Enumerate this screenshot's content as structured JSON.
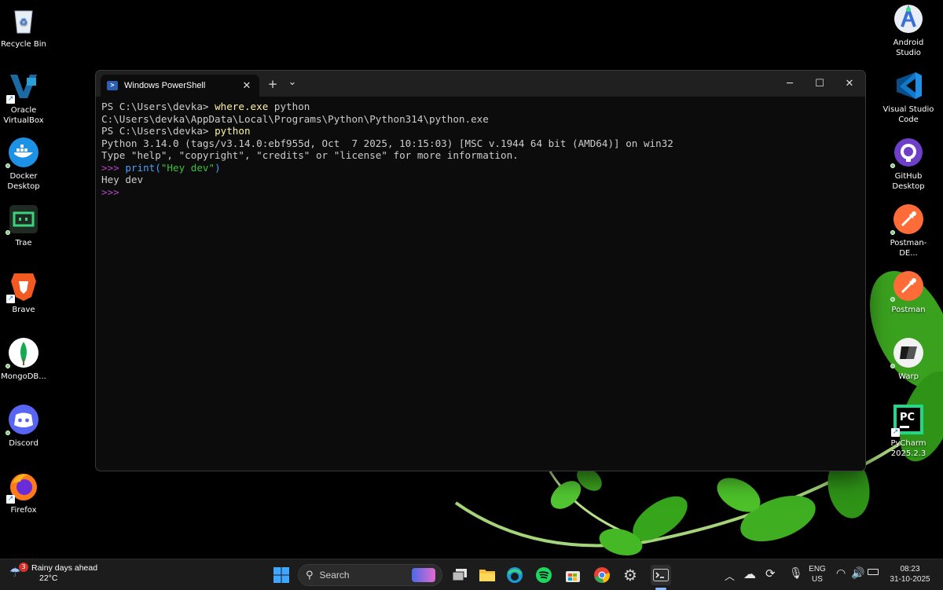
{
  "desktop": {
    "left_icons": [
      {
        "label": "Recycle Bin",
        "icon": "recycle-bin-icon"
      },
      {
        "label": "Oracle VirtualBox",
        "icon": "virtualbox-icon"
      },
      {
        "label": "Docker Desktop",
        "icon": "docker-icon"
      },
      {
        "label": "Trae",
        "icon": "trae-icon"
      },
      {
        "label": "Brave",
        "icon": "brave-icon"
      },
      {
        "label": "MongoDB...",
        "icon": "mongodb-icon"
      },
      {
        "label": "Discord",
        "icon": "discord-icon"
      },
      {
        "label": "Firefox",
        "icon": "firefox-icon"
      }
    ],
    "right_icons": [
      {
        "label": "Android Studio",
        "icon": "android-studio-icon"
      },
      {
        "label": "Visual Studio Code",
        "icon": "vscode-icon"
      },
      {
        "label": "GitHub Desktop",
        "icon": "github-desktop-icon"
      },
      {
        "label": "Postman-DE...",
        "icon": "postman-icon"
      },
      {
        "label": "Postman",
        "icon": "postman-icon"
      },
      {
        "label": "Warp",
        "icon": "warp-icon"
      },
      {
        "label": "PyCharm 2025.2.3",
        "icon": "pycharm-icon"
      }
    ]
  },
  "terminal": {
    "tab_title": "Windows PowerShell",
    "new_tab": "+",
    "dropdown": "⌄",
    "lines": {
      "l1_prompt": "PS C:\\Users\\devka> ",
      "l1_cmd": "where.exe",
      "l1_arg": " python",
      "l2": "C:\\Users\\devka\\AppData\\Local\\Programs\\Python\\Python314\\python.exe",
      "l3_prompt": "PS C:\\Users\\devka> ",
      "l3_cmd": "python",
      "l4": "Python 3.14.0 (tags/v3.14.0:ebf955d, Oct  7 2025, 10:15:03) [MSC v.1944 64 bit (AMD64)] on win32",
      "l5": "Type \"help\", \"copyright\", \"credits\" or \"license\" for more information.",
      "l6_prompt": ">>> ",
      "l6_func": "print(",
      "l6_str": "\"Hey dev\"",
      "l6_close": ")",
      "l7": "Hey dev",
      "l8_prompt": ">>>"
    },
    "colors": {
      "command": "#f9f1a5",
      "repl_prompt": "#b148c6",
      "function": "#4aa0ff",
      "string": "#3fbf3f"
    }
  },
  "taskbar": {
    "weather_badge": "3",
    "weather_title": "Rainy days ahead",
    "weather_temp": "22°C",
    "search_placeholder": "Search",
    "language_top": "ENG",
    "language_bottom": "US",
    "time": "08:23",
    "date": "31-10-2025"
  }
}
